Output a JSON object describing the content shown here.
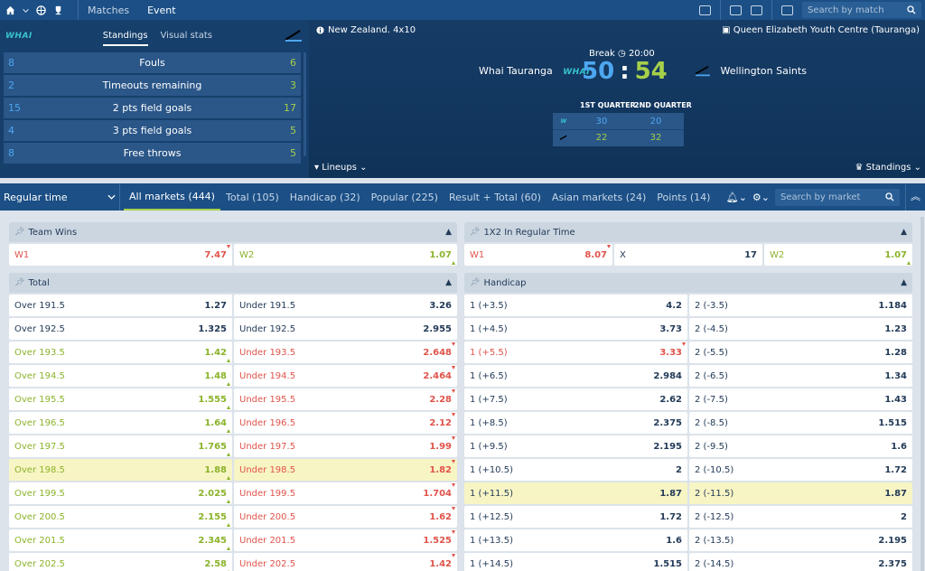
{
  "nav": {
    "tabs": [
      "Matches",
      "Event"
    ],
    "search_placeholder": "Search by match"
  },
  "standings": {
    "tabs": [
      "Standings",
      "Visual stats"
    ],
    "home_logo": "WHAI",
    "rows": [
      {
        "label": "Fouls",
        "home": "8",
        "away": "6"
      },
      {
        "label": "Timeouts remaining",
        "home": "2",
        "away": "3"
      },
      {
        "label": "2 pts field goals",
        "home": "15",
        "away": "17"
      },
      {
        "label": "3 pts field goals",
        "home": "4",
        "away": "5"
      },
      {
        "label": "Free throws",
        "home": "8",
        "away": "5"
      }
    ]
  },
  "match": {
    "league": "New Zealand. 4x10",
    "venue": "Queen Elizabeth Youth Centre (Tauranga)",
    "status": "Break",
    "clock": "20:00",
    "home_team": "Whai Tauranga",
    "home_badge": "WHAI",
    "away_team": "Wellington Saints",
    "home_score": "50",
    "away_score": "54",
    "quarters": [
      "1ST QUARTER",
      "2ND QUARTER"
    ],
    "home_quarters": [
      "30",
      "20"
    ],
    "away_quarters": [
      "22",
      "32"
    ],
    "lineups_label": "Lineups",
    "standings_label": "Standings"
  },
  "markets_bar": {
    "regular_time": "Regular time",
    "tabs": [
      "All markets (444)",
      "Total (105)",
      "Handicap (32)",
      "Popular (225)",
      "Result + Total (60)",
      "Asian markets (24)",
      "Points (14)"
    ],
    "search_placeholder": "Search by market"
  },
  "team_wins": {
    "title": "Team Wins",
    "cells": [
      {
        "name": "W1",
        "odd": "7.47",
        "dir": "down"
      },
      {
        "name": "W2",
        "odd": "1.07",
        "dir": "up"
      }
    ]
  },
  "one_x_two": {
    "title": "1X2 In Regular Time",
    "cells": [
      {
        "name": "W1",
        "odd": "8.07",
        "dir": "down"
      },
      {
        "name": "X",
        "odd": "17",
        "dir": "none"
      },
      {
        "name": "W2",
        "odd": "1.07",
        "dir": "up"
      }
    ]
  },
  "total": {
    "title": "Total",
    "rows": [
      {
        "over": "Over 191.5",
        "over_odd": "1.27",
        "under": "Under 191.5",
        "under_odd": "3.26",
        "dir": "none"
      },
      {
        "over": "Over 192.5",
        "over_odd": "1.325",
        "under": "Under 192.5",
        "under_odd": "2.955",
        "dir": "none"
      },
      {
        "over": "Over 193.5",
        "over_odd": "1.42",
        "under": "Under 193.5",
        "under_odd": "2.648",
        "dir": "move"
      },
      {
        "over": "Over 194.5",
        "over_odd": "1.48",
        "under": "Under 194.5",
        "under_odd": "2.464",
        "dir": "move"
      },
      {
        "over": "Over 195.5",
        "over_odd": "1.555",
        "under": "Under 195.5",
        "under_odd": "2.28",
        "dir": "move"
      },
      {
        "over": "Over 196.5",
        "over_odd": "1.64",
        "under": "Under 196.5",
        "under_odd": "2.12",
        "dir": "move"
      },
      {
        "over": "Over 197.5",
        "over_odd": "1.765",
        "under": "Under 197.5",
        "under_odd": "1.99",
        "dir": "move"
      },
      {
        "over": "Over 198.5",
        "over_odd": "1.88",
        "under": "Under 198.5",
        "under_odd": "1.82",
        "dir": "move",
        "highlight": true
      },
      {
        "over": "Over 199.5",
        "over_odd": "2.025",
        "under": "Under 199.5",
        "under_odd": "1.704",
        "dir": "move"
      },
      {
        "over": "Over 200.5",
        "over_odd": "2.155",
        "under": "Under 200.5",
        "under_odd": "1.62",
        "dir": "move"
      },
      {
        "over": "Over 201.5",
        "over_odd": "2.345",
        "under": "Under 201.5",
        "under_odd": "1.525",
        "dir": "move"
      },
      {
        "over": "Over 202.5",
        "over_odd": "2.58",
        "under": "Under 202.5",
        "under_odd": "1.42",
        "dir": "move"
      }
    ]
  },
  "handicap": {
    "title": "Handicap",
    "rows": [
      {
        "left": "1 (+3.5)",
        "left_odd": "4.2",
        "right": "2 (-3.5)",
        "right_odd": "1.184"
      },
      {
        "left": "1 (+4.5)",
        "left_odd": "3.73",
        "right": "2 (-4.5)",
        "right_odd": "1.23"
      },
      {
        "left": "1 (+5.5)",
        "left_odd": "3.33",
        "right": "2 (-5.5)",
        "right_odd": "1.28",
        "left_dir": "down"
      },
      {
        "left": "1 (+6.5)",
        "left_odd": "2.984",
        "right": "2 (-6.5)",
        "right_odd": "1.34"
      },
      {
        "left": "1 (+7.5)",
        "left_odd": "2.62",
        "right": "2 (-7.5)",
        "right_odd": "1.43"
      },
      {
        "left": "1 (+8.5)",
        "left_odd": "2.375",
        "right": "2 (-8.5)",
        "right_odd": "1.515"
      },
      {
        "left": "1 (+9.5)",
        "left_odd": "2.195",
        "right": "2 (-9.5)",
        "right_odd": "1.6"
      },
      {
        "left": "1 (+10.5)",
        "left_odd": "2",
        "right": "2 (-10.5)",
        "right_odd": "1.72"
      },
      {
        "left": "1 (+11.5)",
        "left_odd": "1.87",
        "right": "2 (-11.5)",
        "right_odd": "1.87",
        "highlight": true
      },
      {
        "left": "1 (+12.5)",
        "left_odd": "1.72",
        "right": "2 (-12.5)",
        "right_odd": "2"
      },
      {
        "left": "1 (+13.5)",
        "left_odd": "1.6",
        "right": "2 (-13.5)",
        "right_odd": "2.195"
      },
      {
        "left": "1 (+14.5)",
        "left_odd": "1.515",
        "right": "2 (-14.5)",
        "right_odd": "2.375"
      }
    ]
  }
}
